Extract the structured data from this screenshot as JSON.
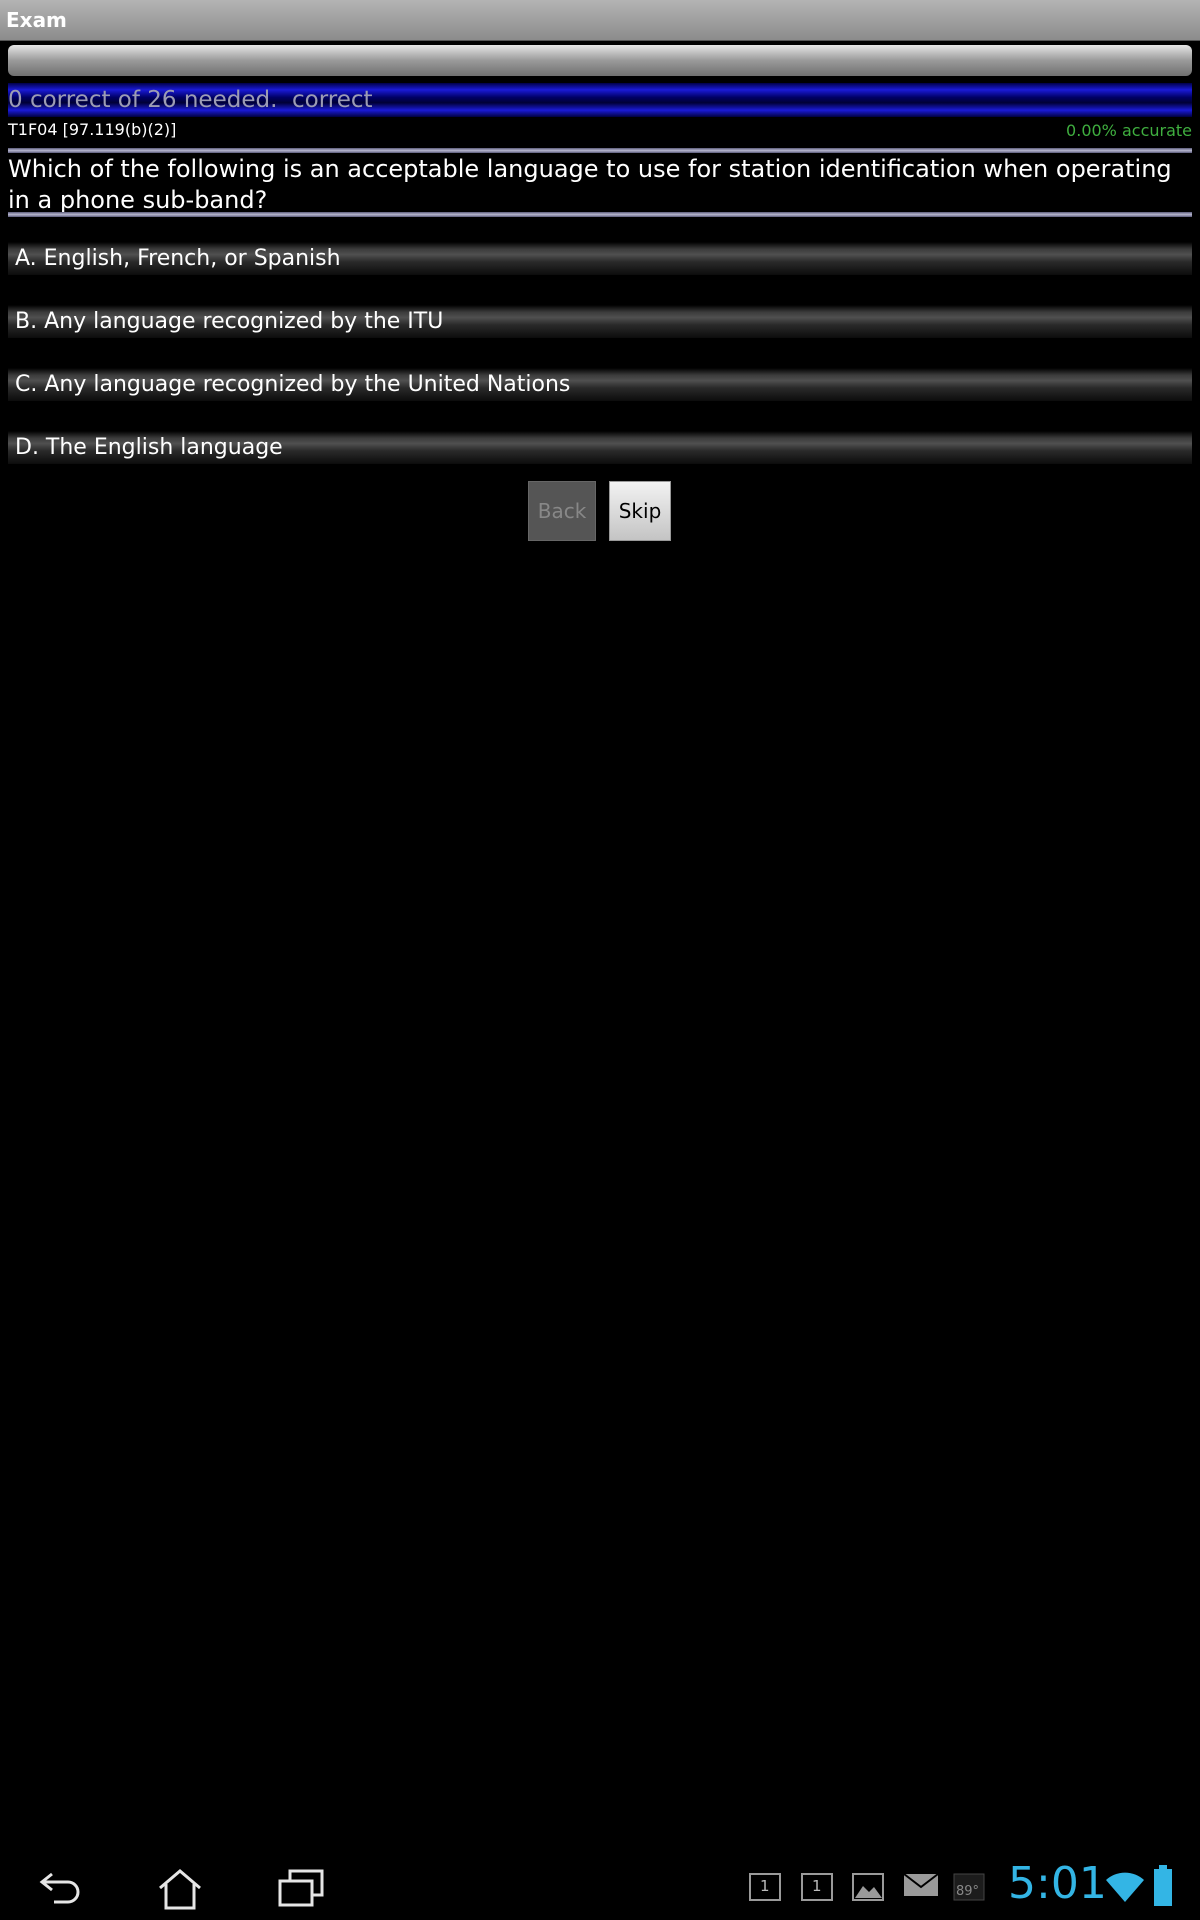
{
  "window": {
    "title": "Exam"
  },
  "progress": {
    "fraction": 0.0
  },
  "score": {
    "text": "0 correct of 26 needed.  correct"
  },
  "question": {
    "id": "T1F04 [97.119(b)(2)]",
    "accuracy": "0.00% accurate",
    "text": "Which of the following is an acceptable language to use for station identification when operating in a phone sub-band?"
  },
  "answers": [
    "A. English, French, or Spanish",
    "B. Any language recognized by the ITU",
    "C. Any language recognized by the United Nations",
    "D. The English language"
  ],
  "buttons": {
    "back": "Back",
    "skip": "Skip"
  },
  "status_bar": {
    "notification_1": "1",
    "notification_2": "1",
    "temperature": "89°",
    "time": "5:01"
  },
  "colors": {
    "clock": "#33b5e5",
    "accuracy": "#3fae3f",
    "score_bar": "#1a1ad6"
  },
  "icons": {
    "back": "back-icon",
    "home": "home-icon",
    "recents": "recent-apps-icon",
    "gallery": "gallery-icon",
    "mail": "mail-icon",
    "wifi": "wifi-icon",
    "battery": "battery-icon"
  }
}
